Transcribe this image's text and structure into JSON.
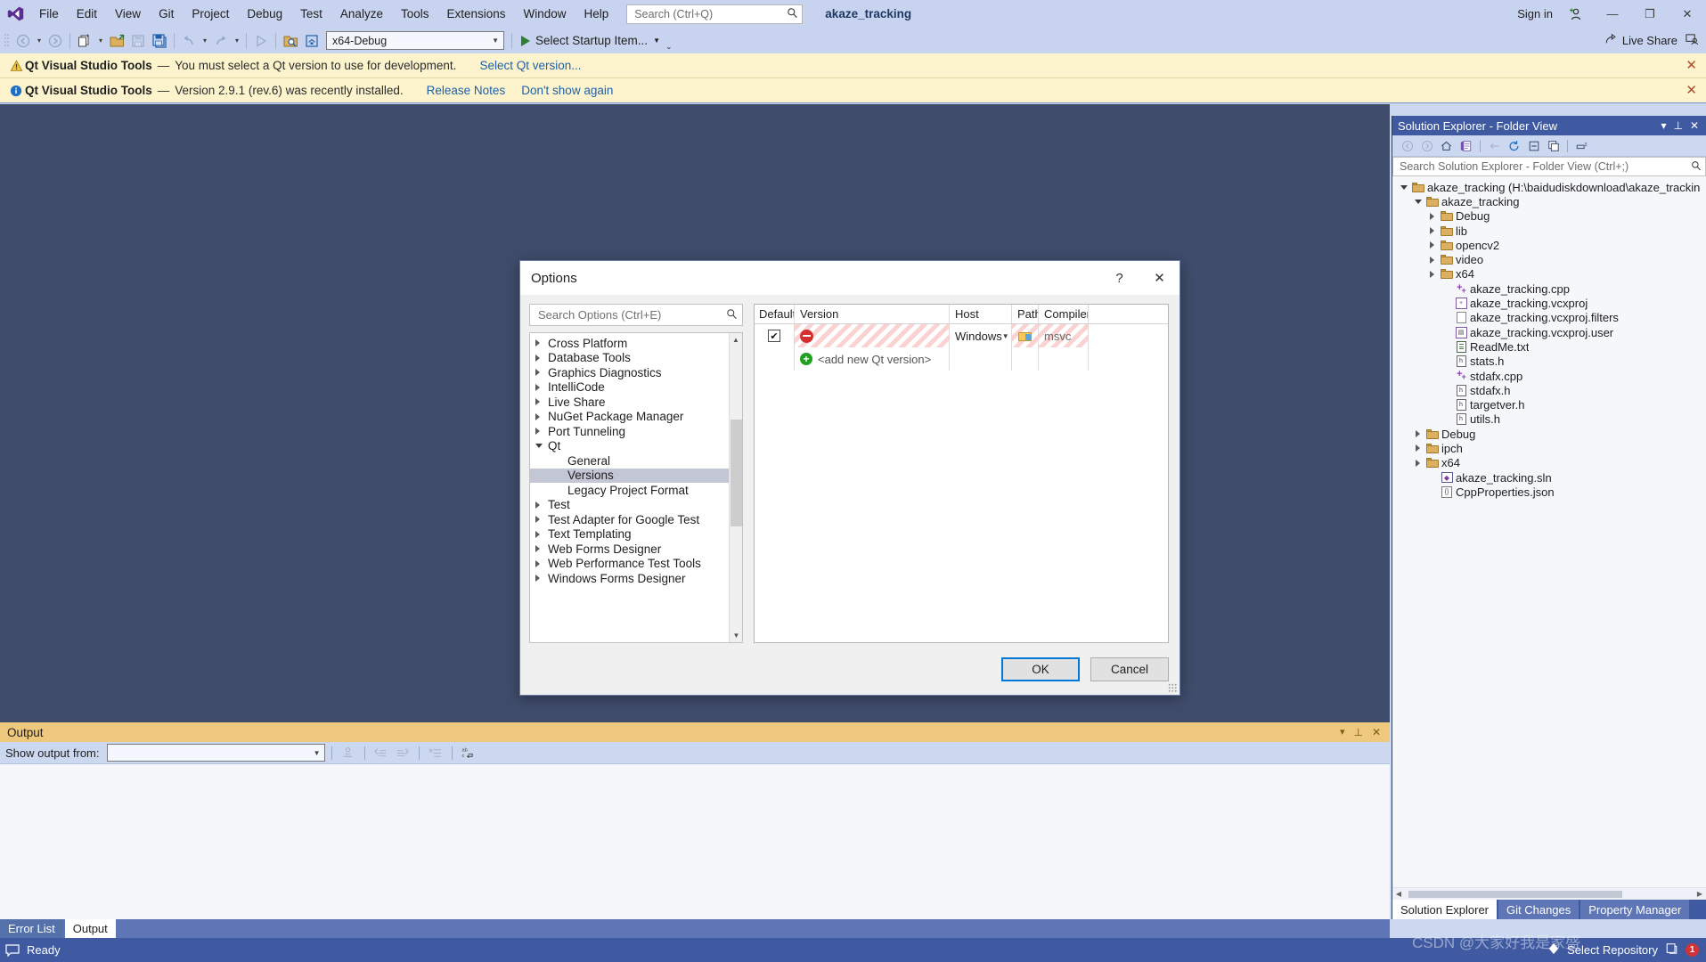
{
  "titlebar": {
    "menu": [
      "File",
      "Edit",
      "View",
      "Git",
      "Project",
      "Debug",
      "Test",
      "Analyze",
      "Tools",
      "Extensions",
      "Window",
      "Help"
    ],
    "search_placeholder": "Search (Ctrl+Q)",
    "project_name": "akaze_tracking",
    "sign_in": "Sign in",
    "minimize": "—",
    "maximize": "❐",
    "close": "✕"
  },
  "toolbar": {
    "configuration": "x64-Debug",
    "startup_item": "Select Startup Item...",
    "live_share": "Live Share"
  },
  "notifications": [
    {
      "icon": "warning-icon",
      "title": "Qt Visual Studio Tools",
      "dash": "—",
      "message": "You must select a Qt version to use for development.",
      "links": [
        "Select Qt version..."
      ],
      "close": "✕"
    },
    {
      "icon": "info-icon",
      "title": "Qt Visual Studio Tools",
      "dash": "—",
      "message": "Version 2.9.1 (rev.6) was recently installed.",
      "links": [
        "Release Notes",
        "Don't show again"
      ],
      "close": "✕"
    }
  ],
  "solution_explorer": {
    "title": "Solution Explorer - Folder View",
    "search_placeholder": "Search Solution Explorer - Folder View (Ctrl+;)",
    "tree": [
      {
        "label": "akaze_tracking (H:\\baidudiskdownload\\akaze_trackin",
        "indent": 0,
        "icon": "folder",
        "state": "expanded"
      },
      {
        "label": "akaze_tracking",
        "indent": 1,
        "icon": "folder",
        "state": "expanded"
      },
      {
        "label": "Debug",
        "indent": 2,
        "icon": "folder",
        "state": "collapsed"
      },
      {
        "label": "lib",
        "indent": 2,
        "icon": "folder",
        "state": "collapsed"
      },
      {
        "label": "opencv2",
        "indent": 2,
        "icon": "folder",
        "state": "collapsed"
      },
      {
        "label": "video",
        "indent": 2,
        "icon": "folder",
        "state": "collapsed"
      },
      {
        "label": "x64",
        "indent": 2,
        "icon": "folder",
        "state": "collapsed"
      },
      {
        "label": "akaze_tracking.cpp",
        "indent": 3,
        "icon": "cpp",
        "state": "leaf"
      },
      {
        "label": "akaze_tracking.vcxproj",
        "indent": 3,
        "icon": "vcxproj",
        "state": "leaf"
      },
      {
        "label": "akaze_tracking.vcxproj.filters",
        "indent": 3,
        "icon": "doc",
        "state": "leaf"
      },
      {
        "label": "akaze_tracking.vcxproj.user",
        "indent": 3,
        "icon": "vcxuser",
        "state": "leaf"
      },
      {
        "label": "ReadMe.txt",
        "indent": 3,
        "icon": "txt",
        "state": "leaf"
      },
      {
        "label": "stats.h",
        "indent": 3,
        "icon": "header",
        "state": "leaf"
      },
      {
        "label": "stdafx.cpp",
        "indent": 3,
        "icon": "cpp",
        "state": "leaf"
      },
      {
        "label": "stdafx.h",
        "indent": 3,
        "icon": "header",
        "state": "leaf"
      },
      {
        "label": "targetver.h",
        "indent": 3,
        "icon": "header",
        "state": "leaf"
      },
      {
        "label": "utils.h",
        "indent": 3,
        "icon": "header",
        "state": "leaf"
      },
      {
        "label": "Debug",
        "indent": 1,
        "icon": "folder",
        "state": "collapsed"
      },
      {
        "label": "ipch",
        "indent": 1,
        "icon": "folder",
        "state": "collapsed"
      },
      {
        "label": "x64",
        "indent": 1,
        "icon": "folder",
        "state": "collapsed"
      },
      {
        "label": "akaze_tracking.sln",
        "indent": 2,
        "icon": "sln",
        "state": "leaf"
      },
      {
        "label": "CppProperties.json",
        "indent": 2,
        "icon": "json",
        "state": "leaf"
      }
    ],
    "tabs": [
      {
        "label": "Solution Explorer",
        "active": true
      },
      {
        "label": "Git Changes",
        "active": false
      },
      {
        "label": "Property Manager",
        "active": false
      }
    ]
  },
  "output_panel": {
    "title": "Output",
    "show_output_from_label": "Show output from:",
    "show_output_from_value": "",
    "tabs": [
      {
        "label": "Error List",
        "active": false
      },
      {
        "label": "Output",
        "active": true
      }
    ]
  },
  "statusbar": {
    "ready": "Ready",
    "select_repository": "Select Repository",
    "error_count": "1"
  },
  "options_dialog": {
    "title": "Options",
    "help_glyph": "?",
    "close_glyph": "✕",
    "search_placeholder": "Search Options (Ctrl+E)",
    "categories": [
      {
        "label": "Cross Platform",
        "level": 0,
        "state": "collapsed",
        "selected": false
      },
      {
        "label": "Database Tools",
        "level": 0,
        "state": "collapsed",
        "selected": false
      },
      {
        "label": "Graphics Diagnostics",
        "level": 0,
        "state": "collapsed",
        "selected": false
      },
      {
        "label": "IntelliCode",
        "level": 0,
        "state": "collapsed",
        "selected": false
      },
      {
        "label": "Live Share",
        "level": 0,
        "state": "collapsed",
        "selected": false
      },
      {
        "label": "NuGet Package Manager",
        "level": 0,
        "state": "collapsed",
        "selected": false
      },
      {
        "label": "Port Tunneling",
        "level": 0,
        "state": "collapsed",
        "selected": false
      },
      {
        "label": "Qt",
        "level": 0,
        "state": "expanded",
        "selected": false
      },
      {
        "label": "General",
        "level": 1,
        "state": "leaf",
        "selected": false
      },
      {
        "label": "Versions",
        "level": 1,
        "state": "leaf",
        "selected": true
      },
      {
        "label": "Legacy Project Format",
        "level": 1,
        "state": "leaf",
        "selected": false
      },
      {
        "label": "Test",
        "level": 0,
        "state": "collapsed",
        "selected": false
      },
      {
        "label": "Test Adapter for Google Test",
        "level": 0,
        "state": "collapsed",
        "selected": false
      },
      {
        "label": "Text Templating",
        "level": 0,
        "state": "collapsed",
        "selected": false
      },
      {
        "label": "Web Forms Designer",
        "level": 0,
        "state": "collapsed",
        "selected": false
      },
      {
        "label": "Web Performance Test Tools",
        "level": 0,
        "state": "collapsed",
        "selected": false
      },
      {
        "label": "Windows Forms Designer",
        "level": 0,
        "state": "collapsed",
        "selected": false
      }
    ],
    "versions_table": {
      "columns": [
        "Default",
        "Version",
        "Host",
        "Path",
        "Compiler",
        ""
      ],
      "rows": [
        {
          "default_checked": true,
          "check_glyph": "✔",
          "version": "",
          "version_error": true,
          "host": "Windows",
          "path": "",
          "compiler": "msvc"
        }
      ],
      "add_row_label": "<add new Qt version>"
    },
    "buttons": {
      "ok": "OK",
      "cancel": "Cancel"
    }
  },
  "watermark": {
    "csdn": "CSDN @大家好我是家盛"
  },
  "colors": {
    "accent_blue": "#3f5aa0",
    "chrome_blue": "#c8d4ef",
    "notification_yellow": "#fdf4ce",
    "output_header": "#eec97d",
    "error_red": "#d32f2f",
    "add_green": "#20a020",
    "focus_blue": "#0078d7"
  }
}
